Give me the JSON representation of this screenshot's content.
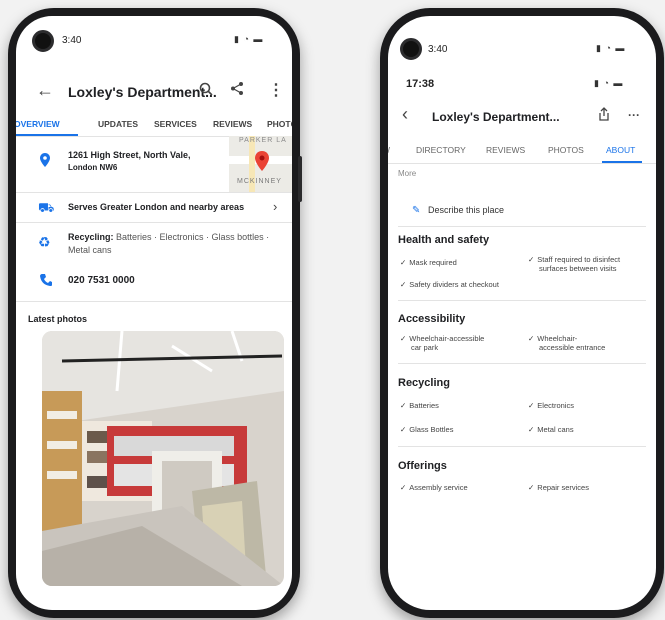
{
  "phone1": {
    "status_time": "3:40",
    "header": {
      "title": "Loxley's Department..."
    },
    "tabs": [
      "OVERVIEW",
      "UPDATES",
      "SERVICES",
      "REVIEWS",
      "PHOTC"
    ],
    "map_labels": {
      "top": "PARKER LA",
      "bottom": "MCKINNEY"
    },
    "address": {
      "line1": "1261 High Street, North Vale,",
      "line2": "London NW6"
    },
    "service_area": "Serves Greater London and nearby areas",
    "recycling": {
      "label": "Recycling:",
      "items": "Batteries · Electronics · Glass bottles ·",
      "items2": "Metal cans"
    },
    "phone": "020 7531 0000",
    "latest_photos": "Latest photos"
  },
  "phone2": {
    "status_time": "3:40",
    "ios_time": "17:38",
    "header": {
      "title": "Loxley's Department..."
    },
    "tabs": [
      "W",
      "DIRECTORY",
      "REVIEWS",
      "PHOTOS",
      "ABOUT"
    ],
    "more": "More",
    "describe": "Describe this place",
    "sections": {
      "health": {
        "title": "Health and safety",
        "items": [
          "Mask required",
          "Staff required to disinfect",
          "surfaces between visits",
          "Safety dividers at checkout"
        ]
      },
      "accessibility": {
        "title": "Accessibility",
        "items": [
          "Wheelchair-accessible",
          "car park",
          "Wheelchair-",
          "accessible entrance"
        ]
      },
      "recycling": {
        "title": "Recycling",
        "items": [
          "Batteries",
          "Electronics",
          "Glass Bottles",
          "Metal cans"
        ]
      },
      "offerings": {
        "title": "Offerings",
        "items": [
          "Assembly service",
          "Repair services"
        ]
      }
    }
  },
  "colors": {
    "accent": "#1a73e8",
    "pin": "#ea4335"
  }
}
